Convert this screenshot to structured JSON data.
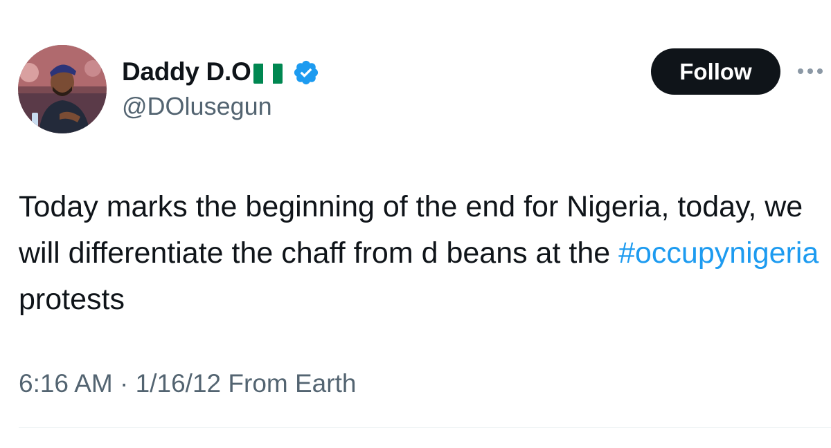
{
  "author": {
    "display_name": "Daddy D.O",
    "flag_emoji": "🇳🇬",
    "handle": "@DOlusegun",
    "verified": true,
    "verified_color": "#1d9bf0"
  },
  "actions": {
    "follow_label": "Follow",
    "more_icon": "more-horizontal-icon"
  },
  "tweet": {
    "text_before": "Today marks the beginning of the end for Nigeria, today, we will differentiate the chaff from d beans at the ",
    "hashtag": "#occupynigeria",
    "text_after": " protests"
  },
  "meta": {
    "time": "6:16 AM",
    "separator": "·",
    "date": "1/16/12",
    "source": "From Earth"
  },
  "colors": {
    "text": "#0f1419",
    "secondary": "#536471",
    "link": "#1d9bf0",
    "follow_bg": "#0f1419",
    "flag_green": "#008751"
  }
}
